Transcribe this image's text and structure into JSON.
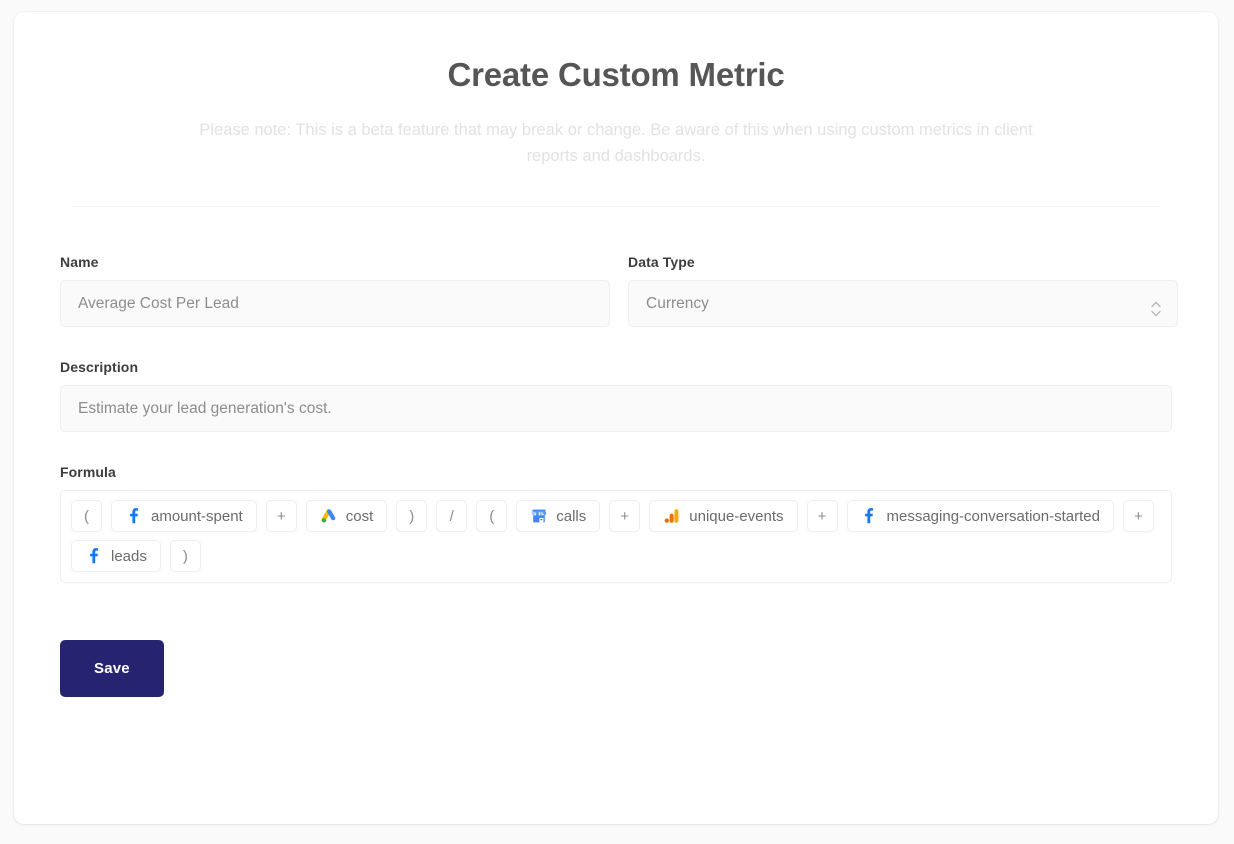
{
  "header": {
    "title": "Create Custom Metric",
    "note": "Please note: This is a beta feature that may break or change. Be aware of this when using custom metrics in client reports and dashboards."
  },
  "form": {
    "name": {
      "label": "Name",
      "value": "Average Cost Per Lead",
      "placeholder": "Average Cost Per Lead"
    },
    "data_type": {
      "label": "Data Type",
      "value": "Currency",
      "options": [
        "Currency"
      ],
      "stepper_icon": "chevron-up-down-icon"
    },
    "description": {
      "label": "Description",
      "value": "Estimate your lead generation's cost.",
      "placeholder": "Estimate your lead generation's cost."
    },
    "formula": {
      "label": "Formula",
      "tokens": [
        {
          "type": "paren",
          "text": "("
        },
        {
          "type": "metric",
          "text": "amount-spent",
          "icon": "facebook-icon"
        },
        {
          "type": "op",
          "text": "+"
        },
        {
          "type": "metric",
          "text": "cost",
          "icon": "google-ads-icon"
        },
        {
          "type": "paren",
          "text": ")"
        },
        {
          "type": "op",
          "text": "/"
        },
        {
          "type": "paren",
          "text": "("
        },
        {
          "type": "metric",
          "text": "calls",
          "icon": "google-business-profile-icon"
        },
        {
          "type": "op",
          "text": "+"
        },
        {
          "type": "metric",
          "text": "unique-events",
          "icon": "google-analytics-icon"
        },
        {
          "type": "op",
          "text": "+"
        },
        {
          "type": "metric",
          "text": "messaging-conversation-started",
          "icon": "facebook-icon"
        },
        {
          "type": "op",
          "text": "+"
        },
        {
          "type": "metric",
          "text": "leads",
          "icon": "facebook-icon"
        },
        {
          "type": "paren",
          "text": ")"
        }
      ]
    }
  },
  "actions": {
    "save_label": "Save"
  },
  "colors": {
    "primary": "#262471",
    "facebook": "#1877f2",
    "google_ads_blue": "#4285f4",
    "google_ads_yellow": "#fbbc04",
    "google_ads_green": "#34a853",
    "google_analytics_orange": "#f9ab00",
    "google_analytics_amber": "#e8710a",
    "card_bg": "#ffffff",
    "page_bg": "#fafafa",
    "field_bg": "#fafafa",
    "border": "#eeeeef",
    "label_text": "#3d3d3f",
    "value_text": "#8d8d90",
    "title_text": "#565656",
    "note_text": "#e2e2e4"
  }
}
